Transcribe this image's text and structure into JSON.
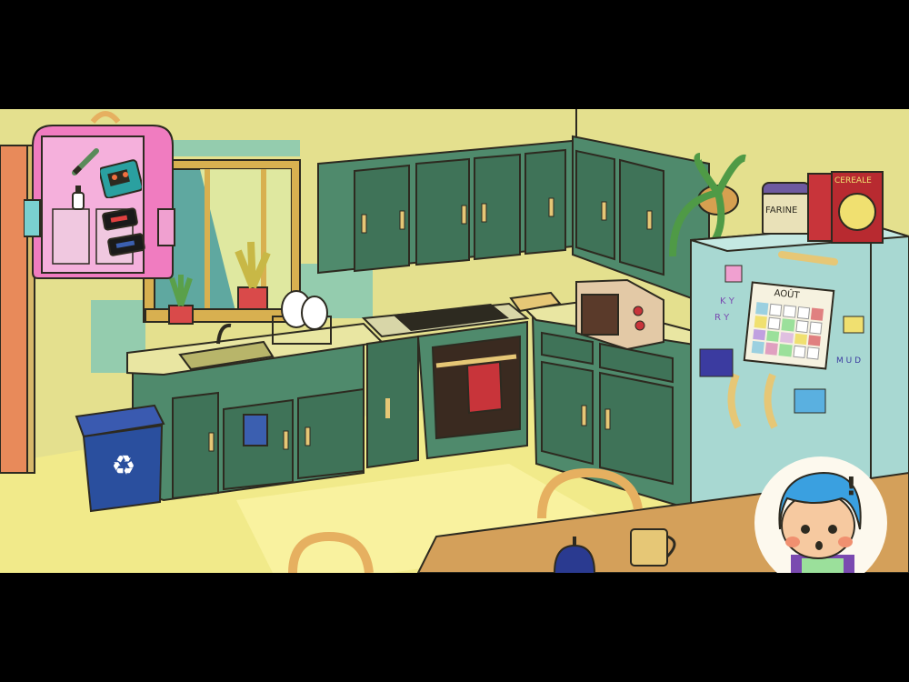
{
  "scene": {
    "name": "kitchen",
    "colors": {
      "wall": "#e4e08e",
      "floor": "#f1ea8a",
      "cabinet": "#4f8a6c",
      "cabinet_dark": "#3f7358",
      "counter": "#e9e6a2",
      "fridge": "#a8d8d2",
      "backpack": "#f07cc0",
      "bin": "#2a4f9e",
      "outline": "#2d2a20"
    }
  },
  "labels": {
    "flour_jar": "FARINE",
    "cereal_box": "CEREALE",
    "calendar_month": "AOÛT",
    "fridge_magnet_letters_1": "K Y",
    "fridge_magnet_letters_2": "R Y",
    "fridge_magnet_word": "M U D"
  },
  "hud": {
    "alert_mark": "!",
    "portrait_label": "character-portrait",
    "inventory_label": "backpack-inventory"
  },
  "inventory": {
    "items": [
      {
        "name": "pen",
        "icon": "pen-icon"
      },
      {
        "name": "radio",
        "icon": "walkman-icon"
      },
      {
        "name": "bottle",
        "icon": "bottle-icon"
      },
      {
        "name": "cassette-1",
        "icon": "cassette-icon"
      },
      {
        "name": "cassette-2",
        "icon": "cassette-icon"
      }
    ]
  }
}
